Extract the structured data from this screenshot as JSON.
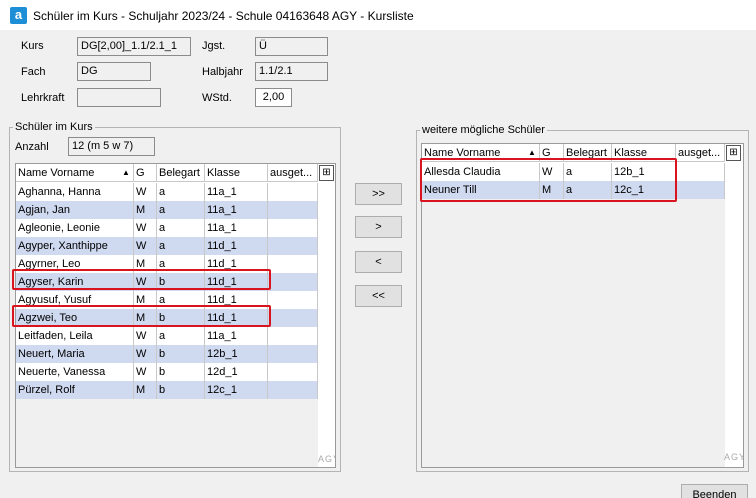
{
  "window": {
    "title": "Schüler im Kurs - Schuljahr 2023/24 - Schule 04163648 AGY  - Kursliste",
    "icon_letter": "a"
  },
  "form": {
    "kurs_label": "Kurs",
    "kurs_value": "DG[2,00]_1.1/2.1_1",
    "jgst_label": "Jgst.",
    "jgst_value": "Ü",
    "fach_label": "Fach",
    "fach_value": "DG",
    "halbjahr_label": "Halbjahr",
    "halbjahr_value": "1.1/2.1",
    "lehrkraft_label": "Lehrkraft",
    "lehrkraft_value": "",
    "wstd_label": "WStd.",
    "wstd_value": "2,00"
  },
  "left_panel": {
    "title": "Schüler im Kurs",
    "anzahl_label": "Anzahl",
    "anzahl_value": "12 (m 5 w 7)",
    "headers": [
      "Name Vorname",
      "G",
      "Belegart",
      "Klasse",
      "ausget..."
    ],
    "rows": [
      [
        "Aghanna, Hanna",
        "W",
        "a",
        "11a_1"
      ],
      [
        "Agjan, Jan",
        "M",
        "a",
        "11a_1"
      ],
      [
        "Agleonie, Leonie",
        "W",
        "a",
        "11a_1"
      ],
      [
        "Agyper, Xanthippe",
        "W",
        "a",
        "11d_1"
      ],
      [
        "Agyrner, Leo",
        "M",
        "a",
        "11d_1"
      ],
      [
        "Agyser, Karin",
        "W",
        "b",
        "11d_1"
      ],
      [
        "Agyusuf, Yusuf",
        "M",
        "a",
        "11d_1"
      ],
      [
        "Agzwei, Teo",
        "M",
        "b",
        "11d_1"
      ],
      [
        "Leitfaden, Leila",
        "W",
        "a",
        "11a_1"
      ],
      [
        "Neuert, Maria",
        "W",
        "b",
        "12b_1"
      ],
      [
        "Neuerte, Vanessa",
        "W",
        "b",
        "12d_1"
      ],
      [
        "Pürzel, Rolf",
        "M",
        "b",
        "12c_1"
      ]
    ],
    "scroll_indicator": "AGY"
  },
  "right_panel": {
    "title": "weitere mögliche Schüler",
    "headers": [
      "Name Vorname",
      "G",
      "Belegart",
      "Klasse",
      "ausget..."
    ],
    "rows": [
      [
        "Allesda Claudia",
        "W",
        "a",
        "12b_1"
      ],
      [
        "Neuner Till",
        "M",
        "a",
        "12c_1"
      ]
    ],
    "scroll_indicator": "AGY"
  },
  "transfer_buttons": {
    "add_all": ">>",
    "add_one": ">",
    "remove_one": "<",
    "remove_all": "<<"
  },
  "footer": {
    "close_label": "Beenden"
  },
  "icons": {
    "sort": "sort-ascending-icon",
    "column_chooser": "column-chooser-icon"
  },
  "colors": {
    "row_stripe": "#cfd9ef",
    "highlight": "#d9141e",
    "app_icon": "#1e8fd6"
  }
}
